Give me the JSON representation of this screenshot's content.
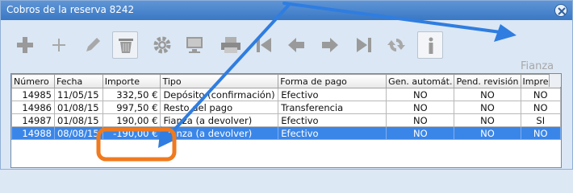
{
  "window": {
    "title": "Cobros de la reserva 8242"
  },
  "toolbar": {
    "buttons": [
      {
        "icon": "plus-bold-icon"
      },
      {
        "icon": "plus-icon"
      },
      {
        "icon": "pencil-icon"
      },
      {
        "icon": "trash-icon"
      },
      {
        "icon": "gear-icon"
      },
      {
        "icon": "monitor-icon"
      },
      {
        "icon": "printer-icon"
      },
      {
        "icon": "first-icon"
      },
      {
        "icon": "previous-icon"
      },
      {
        "icon": "next-icon"
      },
      {
        "icon": "last-icon"
      },
      {
        "icon": "refresh-icon"
      },
      {
        "icon": "info-icon"
      }
    ],
    "side_label": "Fianza"
  },
  "table": {
    "columns": [
      "Número",
      "Fecha",
      "Importe",
      "Tipo",
      "Forma de pago",
      "Gen. automát.",
      "Pend. revisión",
      "Impreso"
    ],
    "rows": [
      [
        "14985",
        "11/05/15",
        "332,50 €",
        "Depósito (confirmación)",
        "Efectivo",
        "NO",
        "NO",
        "NO"
      ],
      [
        "14986",
        "01/08/15",
        "997,50 €",
        "Resto del pago",
        "Transferencia",
        "NO",
        "NO",
        "NO"
      ],
      [
        "14987",
        "01/08/15",
        "190,00 €",
        "Fianza (a devolver)",
        "Efectivo",
        "NO",
        "NO",
        "SI"
      ],
      [
        "14988",
        "08/08/15",
        "-190,00 €",
        "Fianza (a devolver)",
        "Efectivo",
        "NO",
        "NO",
        "NO"
      ]
    ],
    "selected_row": 3
  },
  "colors": {
    "titlebar": "#4a87cf",
    "selection": "#3a86e8",
    "annotation_arrow": "#2f7de0",
    "annotation_highlight": "#f07a1e"
  }
}
